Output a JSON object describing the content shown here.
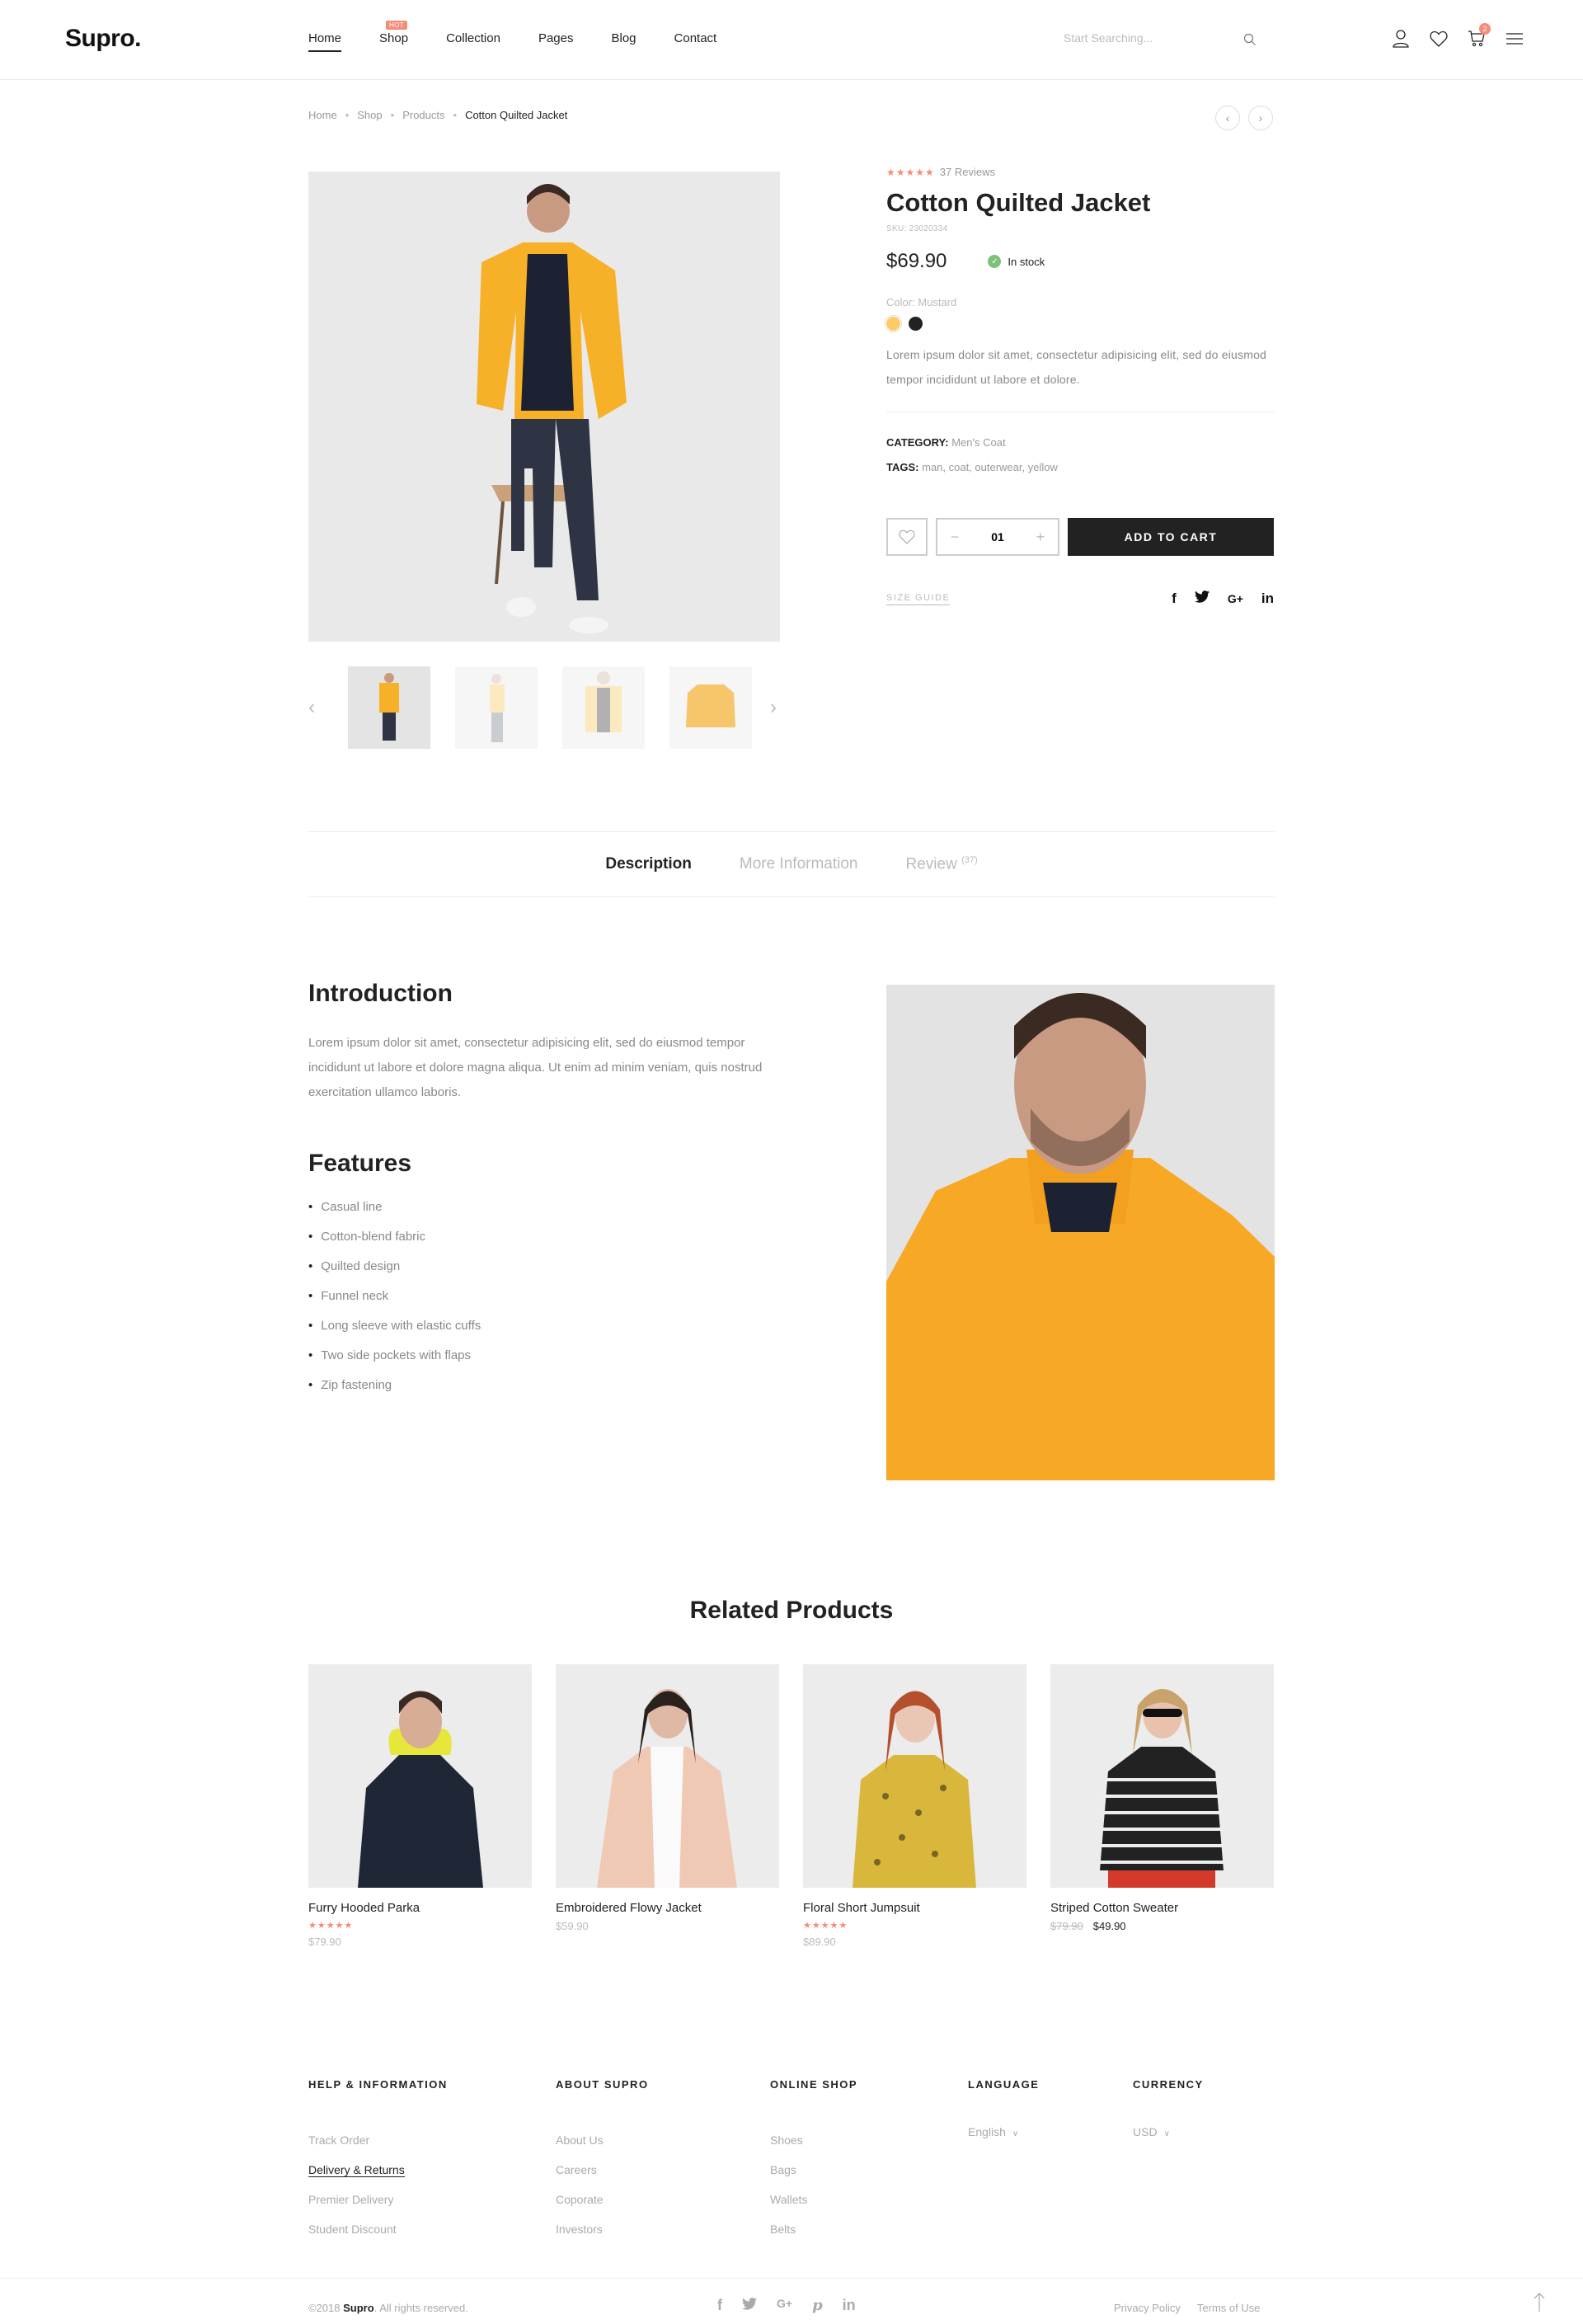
{
  "header": {
    "logo": "Supro.",
    "nav": [
      {
        "label": "Home",
        "active": true
      },
      {
        "label": "Shop",
        "badge": "HOT"
      },
      {
        "label": "Collection"
      },
      {
        "label": "Pages"
      },
      {
        "label": "Blog"
      },
      {
        "label": "Contact"
      }
    ],
    "search_placeholder": "Start Searching...",
    "cart_count": "2",
    "icons": [
      "user-icon",
      "heart-icon",
      "cart-icon",
      "menu-icon"
    ]
  },
  "breadcrumb": {
    "items": [
      "Home",
      "Shop",
      "Products"
    ],
    "current": "Cotton Quilted Jacket"
  },
  "product": {
    "rating": 5,
    "stars": "★★★★★",
    "reviews": "37 Reviews",
    "title": "Cotton Quilted Jacket",
    "sku": "SKU: 23020334",
    "price": "$69.90",
    "stock": "In stock",
    "color_label": "Color: Mustard",
    "colors": [
      "#fecc65",
      "#222222"
    ],
    "short_description": "Lorem ipsum dolor sit amet, consectetur adipisicing elit, sed do eiusmod tempor incididunt ut labore et dolore.",
    "category_label": "CATEGORY:",
    "category": "Men's Coat",
    "tags_label": "TAGS:",
    "tags": "man, coat, outerwear, yellow",
    "quantity": "01",
    "add_to_cart": "ADD TO CART",
    "size_guide": "SIZE GUIDE",
    "share": [
      "f",
      "t",
      "G+",
      "in"
    ],
    "thumbnails": [
      "Front seated view",
      "Side view",
      "Front view",
      "Jacket only"
    ]
  },
  "tabs": [
    {
      "label": "Description",
      "active": true
    },
    {
      "label": "More Information"
    },
    {
      "label": "Review",
      "count": "(37)"
    }
  ],
  "description": {
    "intro_title": "Introduction",
    "intro_text": "Lorem ipsum dolor sit amet, consectetur adipisicing elit, sed do eiusmod tempor incididunt ut labore et dolore magna aliqua. Ut enim ad minim veniam, quis nostrud exercitation ullamco laboris.",
    "features_title": "Features",
    "features": [
      "Casual line",
      "Cotton-blend fabric",
      "Quilted design",
      "Funnel neck",
      "Long sleeve with elastic cuffs",
      "Two side pockets with flaps",
      "Zip fastening"
    ]
  },
  "related": {
    "title": "Related Products",
    "items": [
      {
        "name": "Furry Hooded Parka",
        "stars": "★★★★★",
        "price": "$79.90"
      },
      {
        "name": "Embroidered Flowy Jacket",
        "stars": "",
        "price": "$59.90"
      },
      {
        "name": "Floral Short Jumpsuit",
        "stars": "★★★★★",
        "price": "$89.90"
      },
      {
        "name": "Striped Cotton Sweater",
        "stars": "",
        "old_price": "$79.90",
        "price": "$49.90"
      }
    ]
  },
  "footer": {
    "columns": [
      {
        "title": "HELP & INFORMATION",
        "links": [
          "Track Order",
          "Delivery & Returns",
          "Premier Delivery",
          "Student Discount"
        ]
      },
      {
        "title": "ABOUT SUPRO",
        "links": [
          "About Us",
          "Careers",
          "Coporate",
          "Investors"
        ]
      },
      {
        "title": "ONLINE SHOP",
        "links": [
          "Shoes",
          "Bags",
          "Wallets",
          "Belts"
        ]
      }
    ],
    "language": {
      "title": "LANGUAGE",
      "value": "English"
    },
    "currency": {
      "title": "CURRENCY",
      "value": "USD"
    },
    "copyright_prefix": "©2018 ",
    "copyright_brand": "Supro",
    "copyright_suffix": ". All rights reserved.",
    "socials": [
      "f",
      "t",
      "G+",
      "p",
      "in"
    ],
    "legal": [
      "Privacy Policy",
      "Terms of Use"
    ]
  },
  "colors": {
    "accent": "#f68b76",
    "dark": "#222222",
    "stock_green": "#7cc27a",
    "mustard": "#fecc65"
  }
}
